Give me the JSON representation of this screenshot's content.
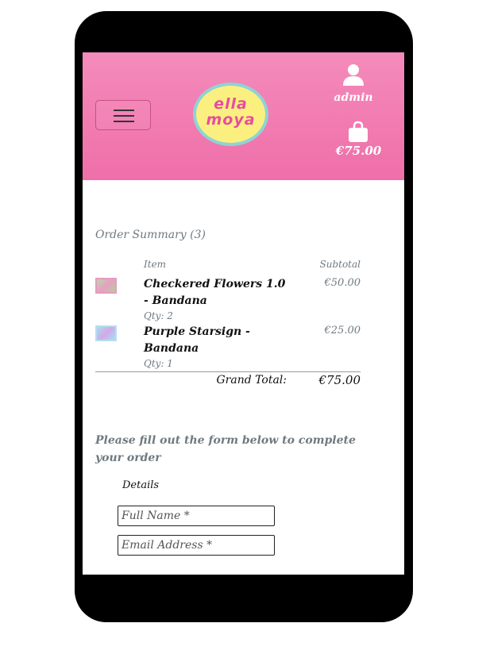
{
  "header": {
    "menu_icon": "hamburger-icon",
    "logo_line1": "ella",
    "logo_line2": "moya",
    "user_label": "admin",
    "bag_total": "€75.00",
    "colors": {
      "header_bg": "#f07db0",
      "logo_fill": "#fbf07f",
      "logo_border": "#8fd3d6",
      "logo_text": "#e94ca0"
    }
  },
  "summary": {
    "title": "Order Summary (3)",
    "col_item": "Item",
    "col_subtotal": "Subtotal",
    "items": [
      {
        "name": "Checkered Flowers 1.0 - Bandana",
        "qty": "Qty: 2",
        "price": "€50.00"
      },
      {
        "name": "Purple Starsign - Bandana",
        "qty": "Qty: 1",
        "price": "€25.00"
      }
    ],
    "grand_label": "Grand Total:",
    "grand_value": "€75.00"
  },
  "form": {
    "intro": "Please fill out the form below to complete your order",
    "details_label": "Details",
    "full_name_placeholder": "Full Name *",
    "email_placeholder": "Email Address *"
  }
}
